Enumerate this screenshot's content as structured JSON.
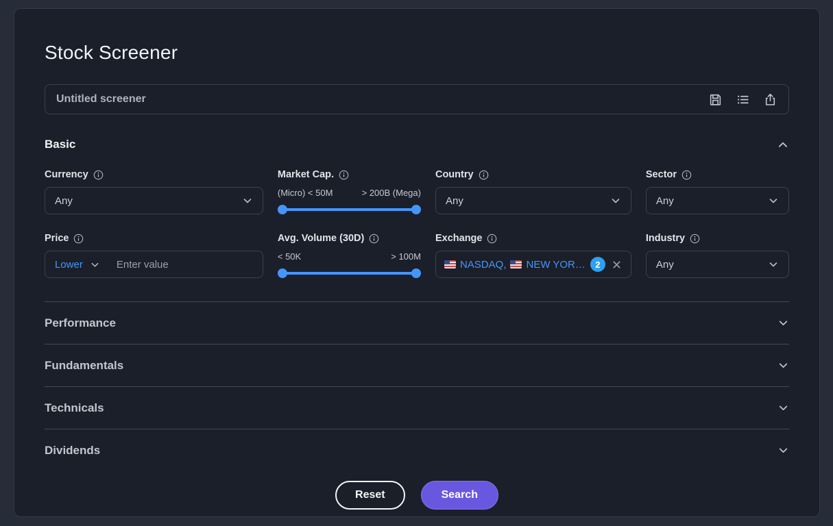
{
  "app": {
    "title": "Stock Screener"
  },
  "name_field": {
    "placeholder": "Untitled screener"
  },
  "toolbar": {
    "icons": [
      "save-icon",
      "list-icon",
      "export-icon"
    ]
  },
  "basic_section": {
    "label": "Basic",
    "expanded": true
  },
  "filters": {
    "currency": {
      "label": "Currency",
      "value": "Any"
    },
    "market_cap": {
      "label": "Market Cap.",
      "min_label": "(Micro) < 50M",
      "max_label": "> 200B (Mega)"
    },
    "country": {
      "label": "Country",
      "value": "Any"
    },
    "sector": {
      "label": "Sector",
      "value": "Any"
    },
    "price": {
      "label": "Price",
      "operator": "Lower",
      "placeholder": "Enter value"
    },
    "avg_volume": {
      "label": "Avg. Volume (30D)",
      "min_label": "< 50K",
      "max_label": "> 100M"
    },
    "exchange": {
      "label": "Exchange",
      "selected_1": "NASDAQ,",
      "selected_2": "NEW YOR…",
      "count": "2"
    },
    "industry": {
      "label": "Industry",
      "value": "Any"
    }
  },
  "collapsed_sections": [
    {
      "label": "Performance"
    },
    {
      "label": "Fundamentals"
    },
    {
      "label": "Technicals"
    },
    {
      "label": "Dividends"
    }
  ],
  "actions": {
    "reset": "Reset",
    "search": "Search"
  },
  "colors": {
    "slider_blue": "#4596fa",
    "link_blue": "#4596fa",
    "badge_blue": "#2f9ff0",
    "search_purple": "#6a57e0"
  }
}
